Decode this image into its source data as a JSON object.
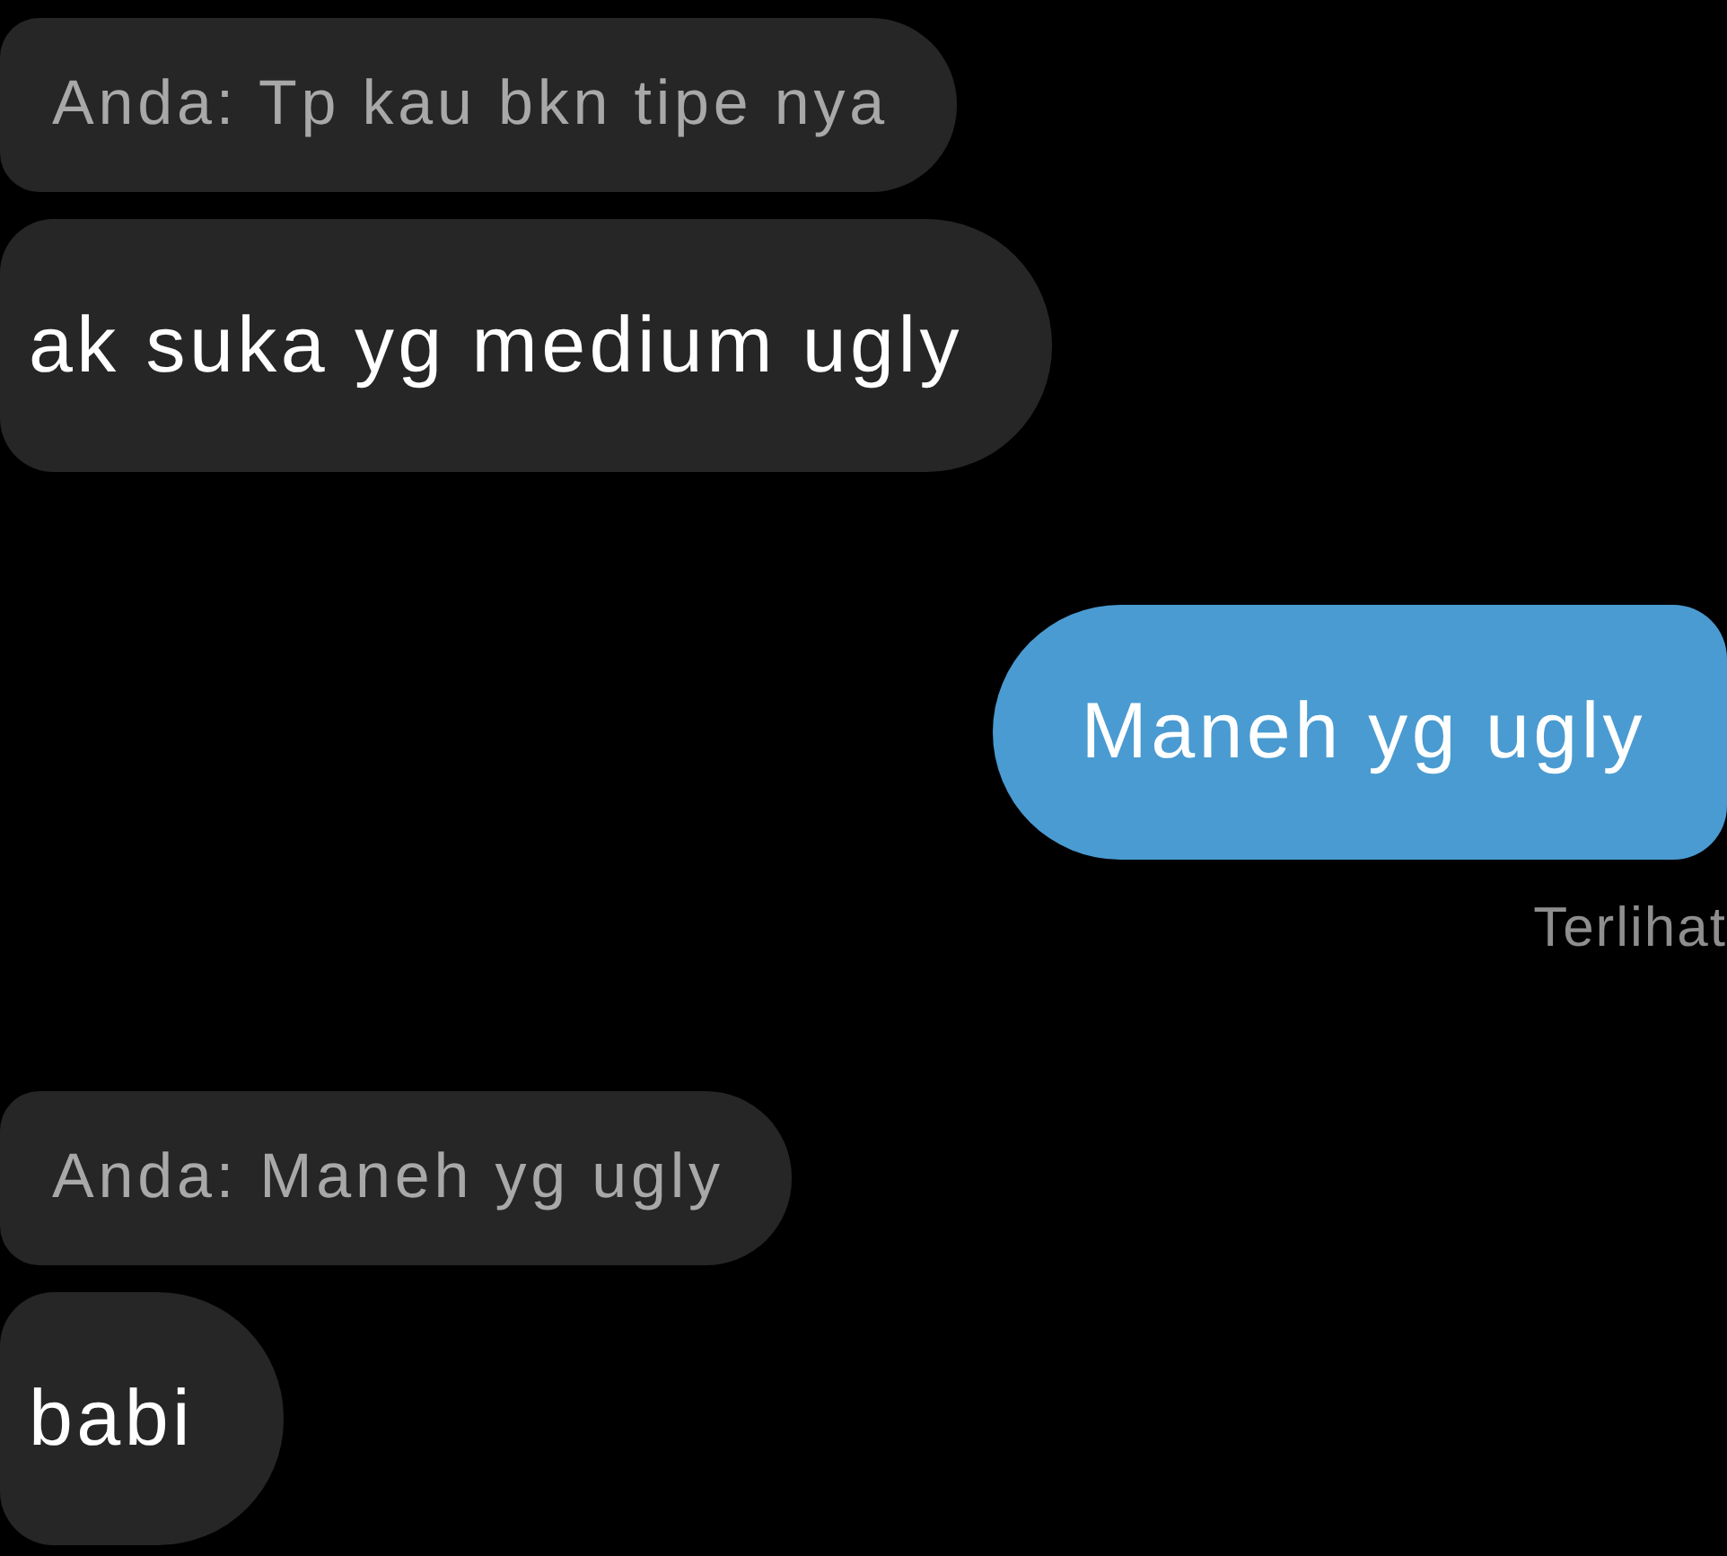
{
  "messages": [
    {
      "kind": "quote",
      "text": "Anda: Tp kau bkn tipe nya"
    },
    {
      "kind": "received",
      "text": "ak suka yg medium ugly"
    },
    {
      "kind": "sent",
      "text": "Maneh yg ugly",
      "status": "Terlihat"
    },
    {
      "kind": "quote",
      "text": "Anda: Maneh yg ugly"
    },
    {
      "kind": "received",
      "text": "babi"
    }
  ]
}
